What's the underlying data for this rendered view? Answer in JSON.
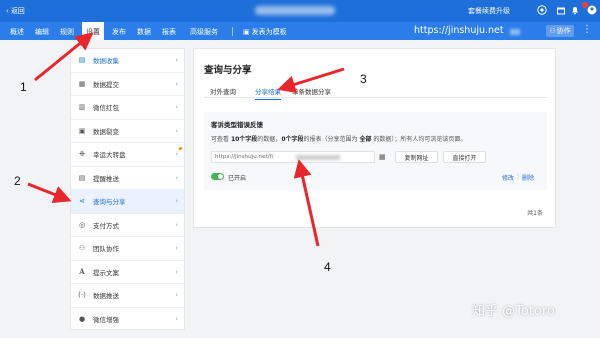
{
  "topbar": {
    "back_label": "返回",
    "upgrade_label": "套餐续费升级",
    "icons": [
      "help-icon",
      "gift-icon",
      "bell-icon",
      "avatar-icon"
    ]
  },
  "navbar": {
    "tabs": [
      {
        "label": "概述"
      },
      {
        "label": "编辑"
      },
      {
        "label": "规则"
      },
      {
        "label": "设置"
      },
      {
        "label": "发布"
      },
      {
        "label": "数据"
      },
      {
        "label": "报表"
      },
      {
        "label": "高级服务"
      }
    ],
    "publish_template_label": "发表为模板",
    "url_text": "https://jinshuju.net",
    "collab_label": "协作",
    "more_label": "⋮"
  },
  "sidebar": {
    "items": [
      {
        "label": "数据收集",
        "icon": "clipboard-icon"
      },
      {
        "label": "数据提交",
        "icon": "submit-icon"
      },
      {
        "label": "微信红包",
        "icon": "red-packet-icon"
      },
      {
        "label": "数据裂变",
        "icon": "fission-icon"
      },
      {
        "label": "幸运大转盘",
        "icon": "wheel-icon"
      },
      {
        "label": "提醒推送",
        "icon": "reminder-icon"
      },
      {
        "label": "查询与分享",
        "icon": "share-icon"
      },
      {
        "label": "支付方式",
        "icon": "payment-icon"
      },
      {
        "label": "团队协作",
        "icon": "team-icon"
      },
      {
        "label": "提示文案",
        "icon": "text-icon"
      },
      {
        "label": "数据推送",
        "icon": "push-icon"
      },
      {
        "label": "微信增强",
        "icon": "wechat-icon"
      }
    ]
  },
  "panel": {
    "title": "查询与分享",
    "tabs": [
      {
        "label": "对外查询"
      },
      {
        "label": "分享结果"
      },
      {
        "label": "单条数据分享"
      }
    ],
    "card": {
      "title": "客诉类型错误反馈",
      "desc_prefix": "可查看",
      "desc_fields_visible": "10个字段",
      "desc_mid1": "的数据，",
      "desc_fields_hidden": "0个字段",
      "desc_mid2": "的报表（分享范围为",
      "desc_scope": "全部",
      "desc_suffix": "的数据）；所有人均可浏览该页面。",
      "url_text": "https://jinshuju.net/f/",
      "copy_button": "复制网址",
      "open_button": "直接打开",
      "toggle_label": "已开启",
      "edit_link": "修改",
      "delete_link": "删除",
      "toggle_on": true
    },
    "count_text": "共1条"
  },
  "annotations": [
    "1",
    "2",
    "3",
    "4"
  ],
  "watermark": "知乎 @Totoro",
  "colors": {
    "primary": "#1e6fd9",
    "nav": "#2b7de9",
    "arrow": "#e8262b",
    "toggle": "#46b35a"
  }
}
